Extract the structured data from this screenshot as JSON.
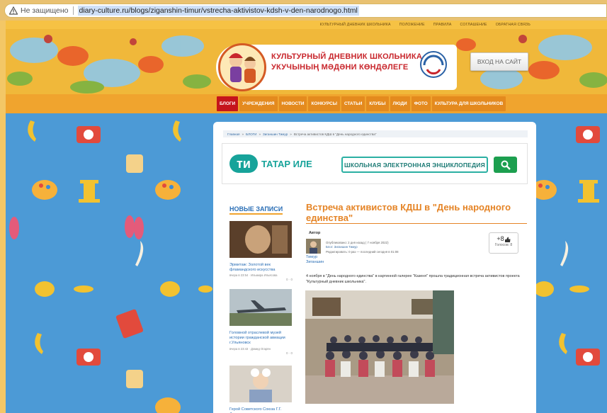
{
  "browser": {
    "security_label": "Не защищено",
    "url": "diary-culture.ru/blogs/ziganshin-timur/vstrecha-aktivistov-kdsh-v-den-narodnogo.html"
  },
  "topbar": {
    "links": [
      "КУЛЬТУРНЫЙ ДНЕВНИК ШКОЛЬНИКА",
      "ПОЛОЖЕНИЕ",
      "ПРАВИЛА",
      "СОГЛАШЕНИЕ",
      "ОБРАТНАЯ СВЯЗЬ"
    ]
  },
  "header": {
    "logo_line1": "КУЛЬТУРНЫЙ ДНЕВНИК ШКОЛЬНИКА",
    "logo_line2": "УКУЧЫНЫҢ МӘДӘНИ КӨНДӘЛЕГЕ",
    "login_label": "ВХОД НА САЙТ"
  },
  "nav": {
    "items": [
      "БЛОГИ",
      "УЧРЕЖДЕНИЯ",
      "НОВОСТИ",
      "КОНКУРСЫ",
      "СТАТЬИ",
      "КЛУБЫ",
      "ЛЮДИ",
      "ФОТО",
      "КУЛЬТУРА ДЛЯ ШКОЛЬНИКОВ"
    ],
    "active_color": "#c5141b"
  },
  "breadcrumb": {
    "items": [
      "Главная",
      "БЛОГИ",
      "Зиганшин Тимур",
      "Встреча активистов КДШ в \"День народного единства\""
    ]
  },
  "encyclopedia": {
    "brand": "ТАТАР ИЛЕ",
    "search_label": "ШКОЛЬНАЯ ЭЛЕКТРОННАЯ ЭНЦИКЛОПЕДИЯ"
  },
  "sidebar": {
    "title": "НОВЫЕ ЗАПИСИ",
    "posts": [
      {
        "caption": "Эрмитаж: Золотой век фламандского искусства",
        "meta": "вчера в 23:54 · Ильмира Ильясова",
        "counts": "0 · 0"
      },
      {
        "caption": "Головной отраслевой музей истории гражданской авиации г.Ульяновск",
        "meta": "вчера в 23:43 · Домид Огарян",
        "counts": "0 · 0"
      },
      {
        "caption": "Герой Советского Союза Г.Г. Фазылов",
        "meta": "",
        "counts": ""
      }
    ]
  },
  "article": {
    "title": "Встреча активистов КДШ в \"День народного единства\"",
    "author_label": "Автор",
    "author_name": "Тимур Зиганшин",
    "published": "Опубликовано: 2 дня назад ( 7 ноября 2022)",
    "blog": "Блог: Зиганшин Тимур",
    "editor": "Редактировать: 0 раз — последний сегодня в 01:08",
    "vote_plus": "+8",
    "vote_count": "Голосов: 8",
    "text": "4 ноября в \"День народного единства\" в картинной галерее \"Казеня\" прошла традиционная встреча активистов проекта \"Культурный дневник школьника\"."
  },
  "colors": {
    "page_bg": "#4c9ad6",
    "accent": "#e58426",
    "link": "#2a6eb5",
    "teal": "#17a39a"
  }
}
